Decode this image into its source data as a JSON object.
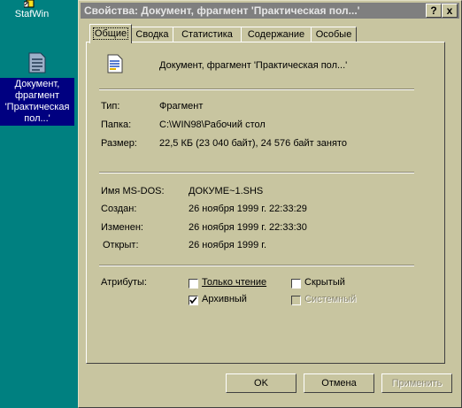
{
  "desktop": {
    "icons": [
      {
        "label": "StafWin"
      },
      {
        "label_lines": [
          "Документ,",
          "фрагмент",
          "'Практическая",
          "пол...'"
        ]
      }
    ]
  },
  "window": {
    "title": "Свойства: Документ, фрагмент 'Практическая пол...'",
    "help_glyph": "?",
    "close_glyph": "x"
  },
  "tabs": [
    {
      "label": "Общие",
      "active": true
    },
    {
      "label": "Сводка"
    },
    {
      "label": "Статистика"
    },
    {
      "label": "Содержание"
    },
    {
      "label": "Особые"
    }
  ],
  "general": {
    "filename": "Документ, фрагмент 'Практическая пол...'",
    "type_label": "Тип:",
    "type_value": "Фрагмент",
    "folder_label": "Папка:",
    "folder_value": "C:\\WIN98\\Рабочий стол",
    "size_label": "Размер:",
    "size_value": "22,5 КБ (23 040 байт), 24 576 байт занято",
    "msdos_label": "Имя MS-DOS:",
    "msdos_value": "ДОКУМЕ~1.SHS",
    "created_label": "Создан:",
    "created_value": "26 ноября 1999 г. 22:33:29",
    "modified_label": "Изменен:",
    "modified_value": "26 ноября 1999 г. 22:33:30",
    "opened_label": "Открыт:",
    "opened_value": "26 ноября 1999 г.",
    "attributes_label": "Атрибуты:"
  },
  "attributes": {
    "readonly": {
      "label": "Только чтение",
      "checked": false
    },
    "hidden": {
      "label": "Скрытый",
      "checked": false
    },
    "archive": {
      "label": "Архивный",
      "checked": true
    },
    "system": {
      "label": "Системный",
      "checked": false,
      "disabled": true
    }
  },
  "buttons": {
    "ok": "OK",
    "cancel": "Отмена",
    "apply": "Применить"
  },
  "colors": {
    "desktop": "#008080",
    "dialog_face": "#c8c5a0",
    "titlebar_inactive": "#7f7f7f",
    "selection": "#000080"
  }
}
